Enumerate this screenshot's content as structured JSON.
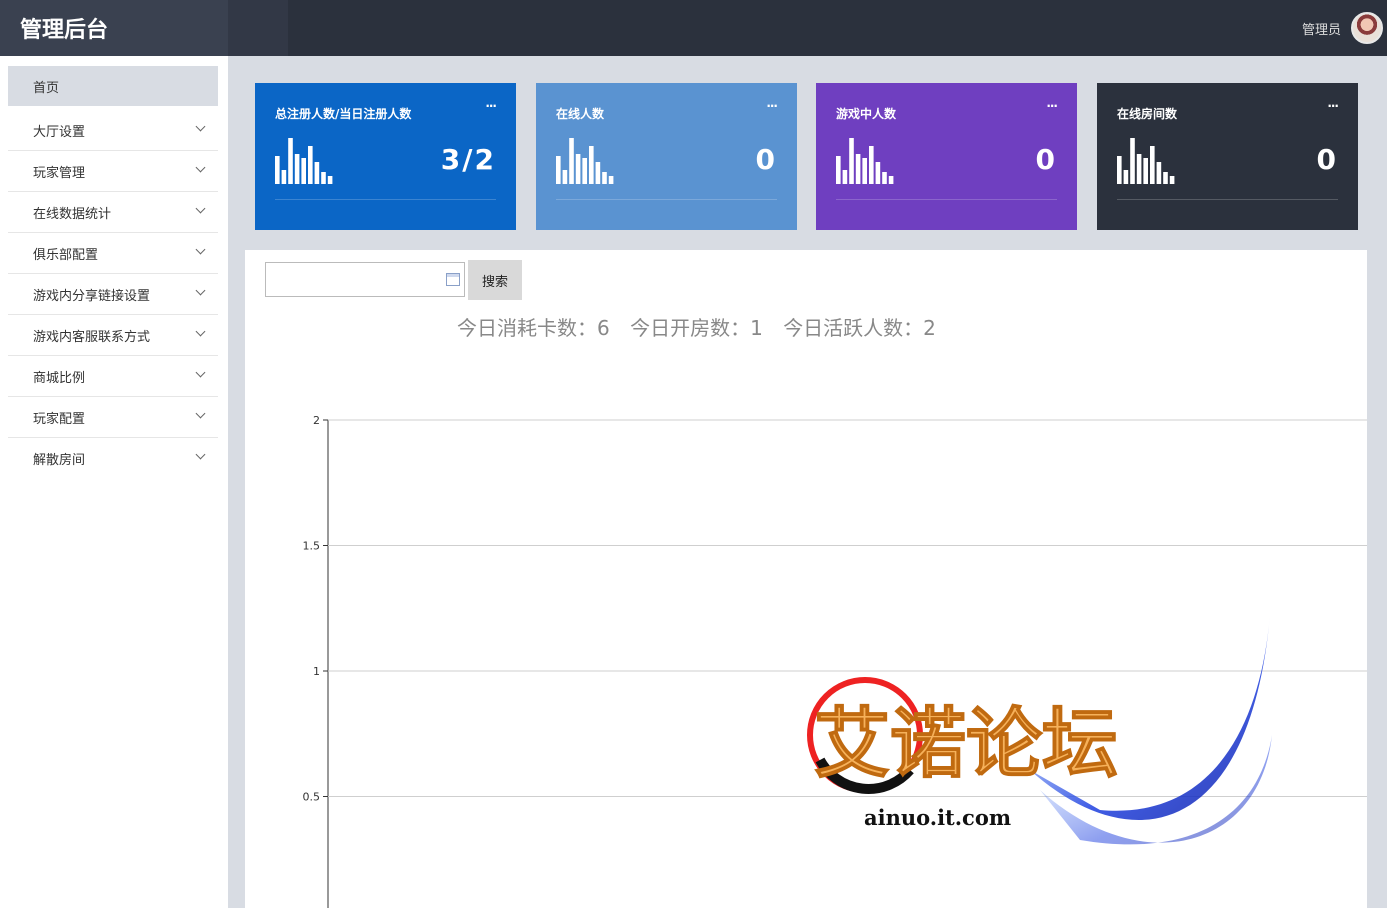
{
  "header": {
    "title": "管理后台",
    "user_name": "管理员"
  },
  "sidebar": {
    "items": [
      {
        "label": "首页",
        "active": true
      },
      {
        "label": "大厅设置"
      },
      {
        "label": "玩家管理"
      },
      {
        "label": "在线数据统计"
      },
      {
        "label": "俱乐部配置"
      },
      {
        "label": "游戏内分享链接设置"
      },
      {
        "label": "游戏内客服联系方式"
      },
      {
        "label": "商城比例"
      },
      {
        "label": "玩家配置"
      },
      {
        "label": "解散房间"
      }
    ]
  },
  "cards": [
    {
      "label": "总注册人数/当日注册人数",
      "value": "3/2",
      "color": "#0b66c6",
      "menu": "···"
    },
    {
      "label": "在线人数",
      "value": "0",
      "color": "#5a93d1",
      "menu": "···"
    },
    {
      "label": "游戏中人数",
      "value": "0",
      "color": "#6f3fc0",
      "menu": "···"
    },
    {
      "label": "在线房间数",
      "value": "0",
      "color": "#2b313d",
      "menu": "···"
    }
  ],
  "search": {
    "date_value": "",
    "button_label": "搜索"
  },
  "stats": {
    "cards_used": "今日消耗卡数：6",
    "rooms_opened": "今日开房数：1",
    "active_users": "今日活跃人数：2"
  },
  "chart_data": {
    "type": "line",
    "y_ticks": [
      "2",
      "1.5",
      "1",
      "0.5"
    ],
    "ylim": [
      0,
      2
    ],
    "grid": true,
    "series": []
  },
  "watermark": {
    "text": "艾诺论坛",
    "url": "ainuo.it.com"
  }
}
